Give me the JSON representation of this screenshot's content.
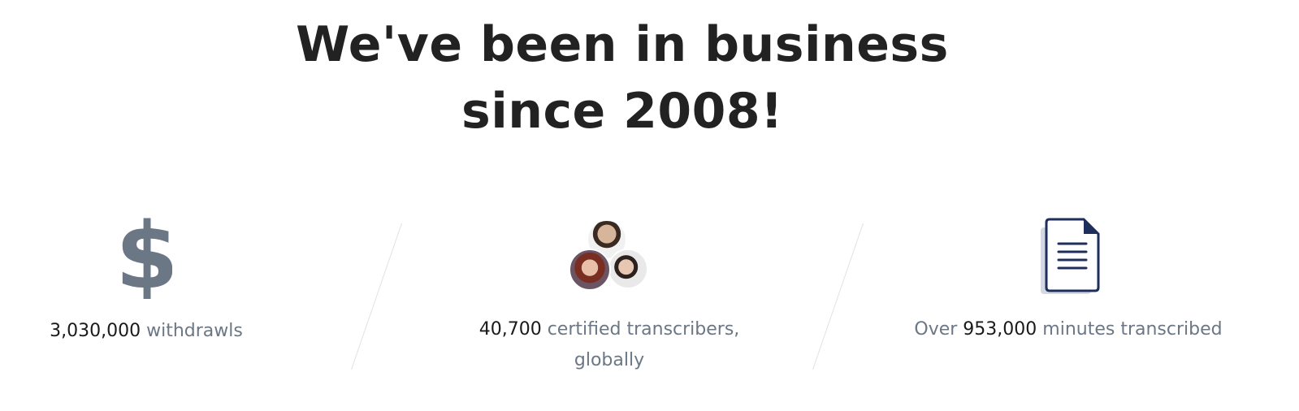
{
  "headline": {
    "line1": "We've been in business",
    "line2": "since 2008!"
  },
  "stats": [
    {
      "icon": "dollar-icon",
      "prefix": "",
      "number": "3,030,000",
      "suffix": "withdrawls",
      "suffix_line2": ""
    },
    {
      "icon": "avatars-icon",
      "prefix": "",
      "number": "40,700",
      "suffix": "certified transcribers,",
      "suffix_line2": "globally"
    },
    {
      "icon": "document-icon",
      "prefix": "Over",
      "number": "953,000",
      "suffix": "minutes transcribed",
      "suffix_line2": ""
    }
  ],
  "colors": {
    "heading": "#222222",
    "muted_text": "#6b7785",
    "number_text": "#1a1a1a",
    "dollar_icon": "#6b7785",
    "document_stroke": "#1f2f5c",
    "document_shadow": "#d4d8e2"
  }
}
